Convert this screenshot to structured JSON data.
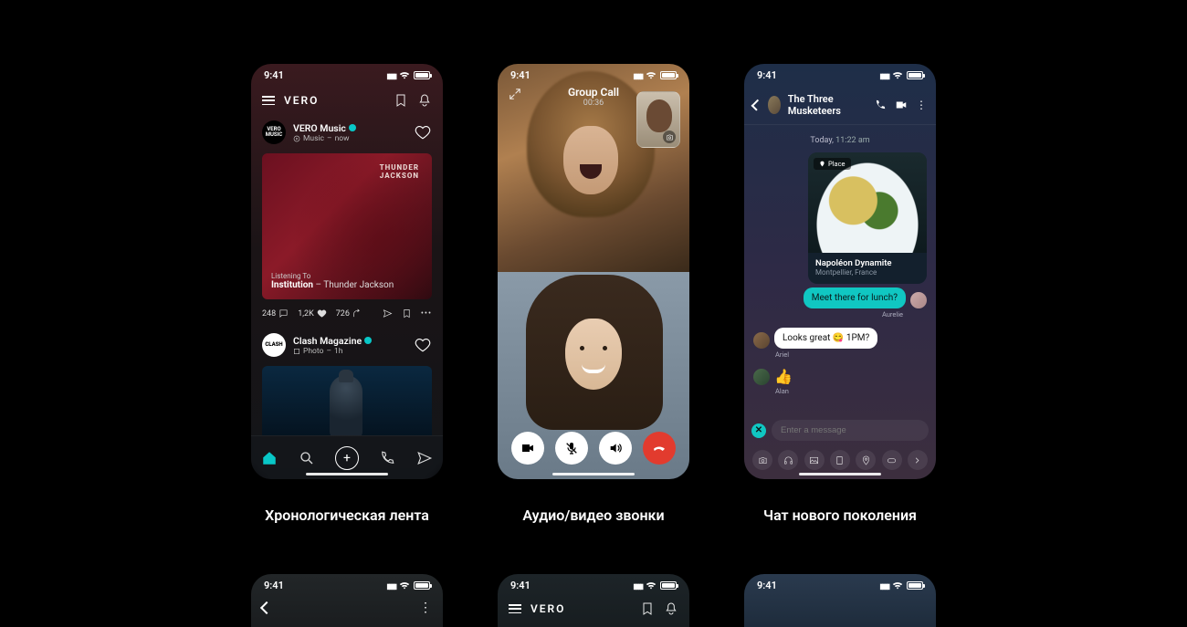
{
  "status_time": "9:41",
  "captions": {
    "feed": "Хронологическая лента",
    "calls": "Аудио/видео звонки",
    "chat": "Чат нового поколения"
  },
  "feed": {
    "brand": "VERO",
    "post1": {
      "user": "VERO Music",
      "meta_type": "Music",
      "meta_time": "now",
      "album_line1": "THUNDER",
      "album_line2": "JACKSON",
      "np_label": "Listening To",
      "np_track": "Institution",
      "np_artist": " – Thunder Jackson",
      "comments": "248",
      "likes": "1,2K",
      "shares": "726"
    },
    "post2": {
      "user": "Clash Magazine",
      "avatar_text": "CLASH",
      "meta_type": "Photo",
      "meta_time": "1h"
    }
  },
  "call": {
    "title": "Group Call",
    "duration": "00:36"
  },
  "chat": {
    "title": "The Three Musketeers",
    "day_label": "Today,",
    "day_time": "11:22 am",
    "place_tag": "Place",
    "place_name": "Napoléon Dynamite",
    "place_loc": "Montpellier, France",
    "msg_out": "Meet there for lunch?",
    "sender_out": "Aurelie",
    "msg_in": "Looks great 😋 1PM?",
    "sender_in": "Ariel",
    "react": "👍",
    "sender_react": "Alan",
    "placeholder": "Enter a message"
  },
  "peek": {
    "brand": "VERO"
  }
}
